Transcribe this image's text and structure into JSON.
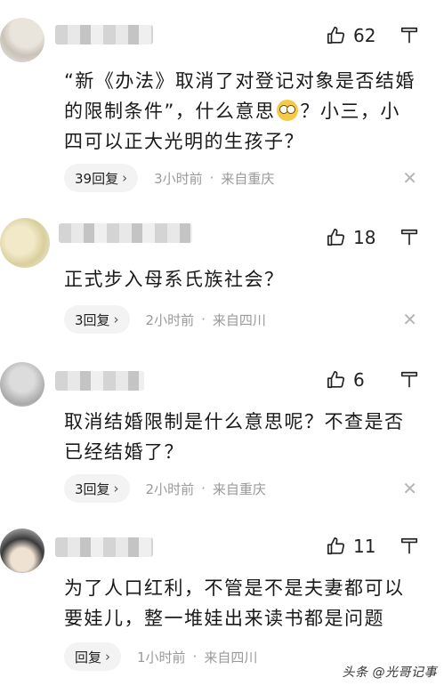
{
  "comments": [
    {
      "likes": "62",
      "text_a": "“新《办法》取消了对登记对象是否结婚的限制条件”，什么意思",
      "text_b": "？小三，小四可以正大光明的生孩子？",
      "reply": "39回复",
      "time": "3小时前",
      "location": "来自重庆"
    },
    {
      "likes": "18",
      "text": "正式步入母系氏族社会？",
      "reply": "3回复",
      "time": "2小时前",
      "location": "来自四川"
    },
    {
      "likes": "6",
      "text": "取消结婚限制是什么意思呢？不查是否已经结婚了？",
      "reply": "3回复",
      "time": "2小时前",
      "location": "来自重庆"
    },
    {
      "likes": "11",
      "text": "为了人口红利，不管是不是夫妻都可以要娃儿，整一堆娃出来读书都是问题",
      "reply": "回复",
      "time": "1小时前",
      "location": "来自四川"
    }
  ],
  "separator": "·",
  "chevron": "›",
  "close_glyph": "✕",
  "watermark": "头条 @光哥记事",
  "colors": {
    "meta_gray": "#9a9a9a",
    "pill_bg": "#f3f3f3",
    "emoji": "#f7c948"
  },
  "icons": [
    "thumbs-up-icon",
    "thumbs-down-icon",
    "chevron-right-icon",
    "close-icon",
    "confused-face-emoji"
  ]
}
